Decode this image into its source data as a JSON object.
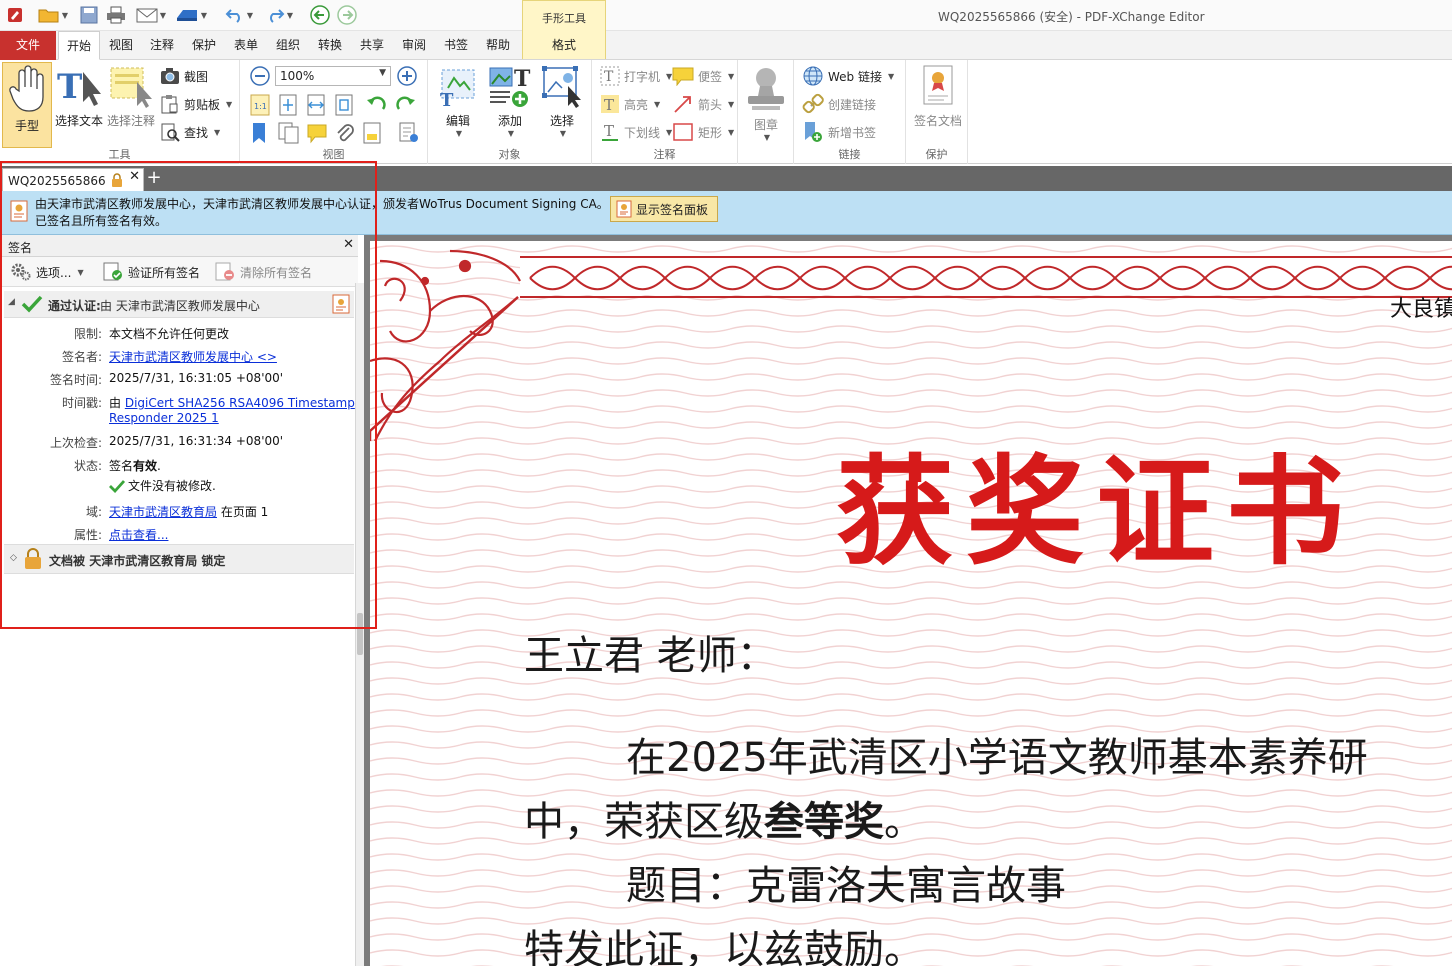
{
  "window": {
    "title": "WQ2025565866 (安全) - PDF-XChange Editor",
    "context_group": "手形工具"
  },
  "ribbon_tabs": [
    "文件",
    "开始",
    "视图",
    "注释",
    "保护",
    "表单",
    "组织",
    "转换",
    "共享",
    "审阅",
    "书签",
    "帮助",
    "格式"
  ],
  "ribbon": {
    "tools": {
      "label": "工具",
      "hand": "手型",
      "select_text": "选择文本",
      "select_comment": "选择注释",
      "snapshot": "截图",
      "clipboard": "剪贴板",
      "find": "查找"
    },
    "view": {
      "label": "视图",
      "zoom_value": "100%"
    },
    "objects": {
      "label": "对象",
      "edit": "编辑",
      "add": "添加",
      "select": "选择"
    },
    "comments": {
      "label": "注释",
      "typewriter": "打字机",
      "highlight": "高亮",
      "underline": "下划线",
      "sticky": "便签",
      "arrow": "箭头",
      "rect": "矩形"
    },
    "stamp": {
      "label": "图章"
    },
    "links": {
      "label": "链接",
      "web": "Web 链接",
      "create": "创建链接",
      "bookmark": "新增书签"
    },
    "protect": {
      "label": "保护",
      "sign": "签名文档"
    }
  },
  "document_tab": {
    "title": "WQ2025565866"
  },
  "infobar": {
    "line1": "由天津市武清区教师发展中心，天津市武清区教师发展中心认证，颁发者WoTrus Document Signing CA。",
    "line2": "已签名且所有签名有效。",
    "button": "显示签名面板"
  },
  "signature_panel": {
    "title": "签名",
    "options": "选项...",
    "verify_all": "验证所有签名",
    "clear_all": "清除所有签名",
    "sig_header_status": "通过认证:",
    "sig_header_by": "由 天津市武清区教师发展中心",
    "rows": [
      {
        "key": "限制:",
        "value": "本文档不允许任何更改"
      },
      {
        "key": "签名者:",
        "value": "天津市武清区教师发展中心 <>"
      },
      {
        "key": "签名时间:",
        "value": "2025/7/31, 16:31:05 +08'00'"
      },
      {
        "key": "时间戳:",
        "prefix": "由 ",
        "value": "DigiCert SHA256 RSA4096 Timestamp",
        "value2": "Responder 2025 1"
      },
      {
        "key": "上次检查:",
        "value": "2025/7/31, 16:31:34 +08'00'"
      },
      {
        "key": "状态:",
        "prefix": "签名",
        "bold": "有效",
        "suffix": ".",
        "value2": "文件没有被修改."
      },
      {
        "key": "域:",
        "value": "天津市武清区教育局",
        "suffix": " 在页面 1"
      },
      {
        "key": "属性:",
        "value": "点击查看..."
      }
    ],
    "lock_status": "文档被",
    "lock_by": "天津市武清区教育局",
    "lock_suffix": "锁定"
  },
  "certificate": {
    "corner_text": "大良镇",
    "title": "获奖证书",
    "recipient": "王立君 老师：",
    "body1": "在2025年武清区小学语文教师基本素养研",
    "body2a": "中，荣获区级",
    "body2b": "叁等奖",
    "body2c": "。",
    "topic": "题目：克雷洛夫寓言故事",
    "closing": "特发此证，以兹鼓励。"
  },
  "colors": {
    "file_tab": "#c8312e",
    "accent_red": "#d61a1a",
    "highlight_box": "#e0201a",
    "infobar": "#bde0f4",
    "check_green": "#3aa53a"
  }
}
